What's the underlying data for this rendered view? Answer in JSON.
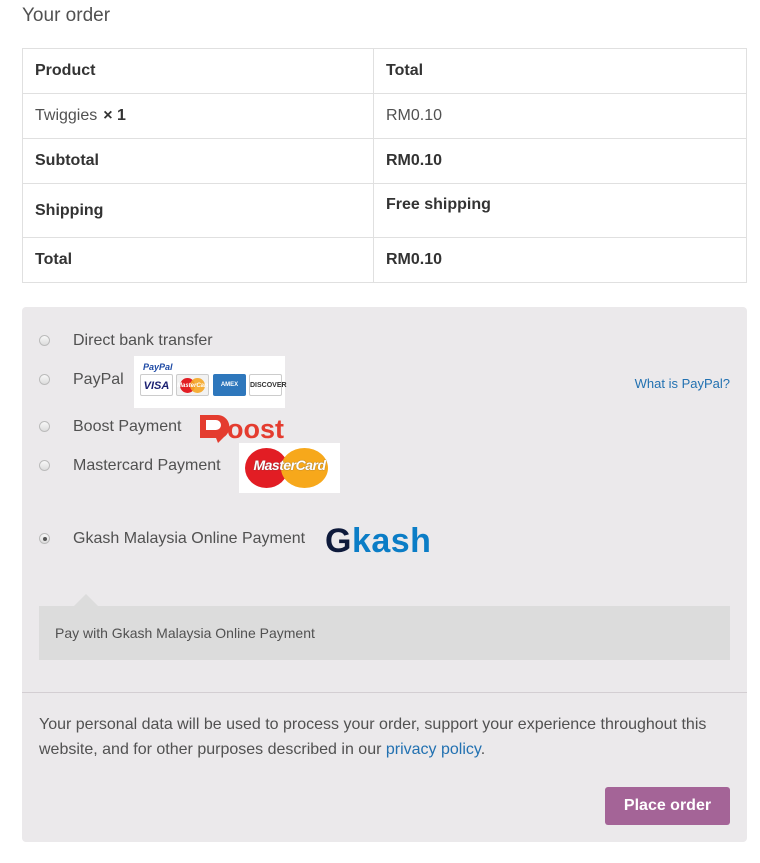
{
  "order": {
    "title": "Your order",
    "headers": {
      "product": "Product",
      "total": "Total"
    },
    "item": {
      "name": "Twiggies",
      "qty": "× 1",
      "total": "RM0.10"
    },
    "subtotal": {
      "label": "Subtotal",
      "value": "RM0.10"
    },
    "shipping": {
      "label": "Shipping",
      "value": "Free shipping"
    },
    "total": {
      "label": "Total",
      "value": "RM0.10"
    }
  },
  "payment": {
    "methods": [
      {
        "label": "Direct bank transfer",
        "checked": false
      },
      {
        "label": "PayPal",
        "checked": false,
        "icon": "paypal-acceptance-mark-icon",
        "link": "What is PayPal?"
      },
      {
        "label": "Boost Payment",
        "checked": false,
        "icon": "boost-logo-icon"
      },
      {
        "label": "Mastercard Payment",
        "checked": false,
        "icon": "mastercard-logo-icon"
      },
      {
        "label": "Gkash Malaysia Online Payment",
        "checked": true,
        "icon": "gkash-logo-icon"
      }
    ],
    "paypal_logo": {
      "brand": "PayPal",
      "cards": [
        "VISA",
        "MasterCard",
        "AMEX",
        "DISCOVER"
      ]
    },
    "boost_logo_text": "Boost",
    "mastercard_logo_text": "MasterCard",
    "gkash_logo": {
      "g": "G",
      "rest": "kash"
    },
    "selected_description": "Pay with Gkash Malaysia Online Payment"
  },
  "privacy": {
    "text": "Your personal data will be used to process your order, support your experience throughout this website, and for other purposes described in our ",
    "link": "privacy policy",
    "end": "."
  },
  "place_order_label": "Place order",
  "colors": {
    "accent": "#a46497",
    "link": "#2271b1",
    "panel": "#ebe9eb"
  }
}
